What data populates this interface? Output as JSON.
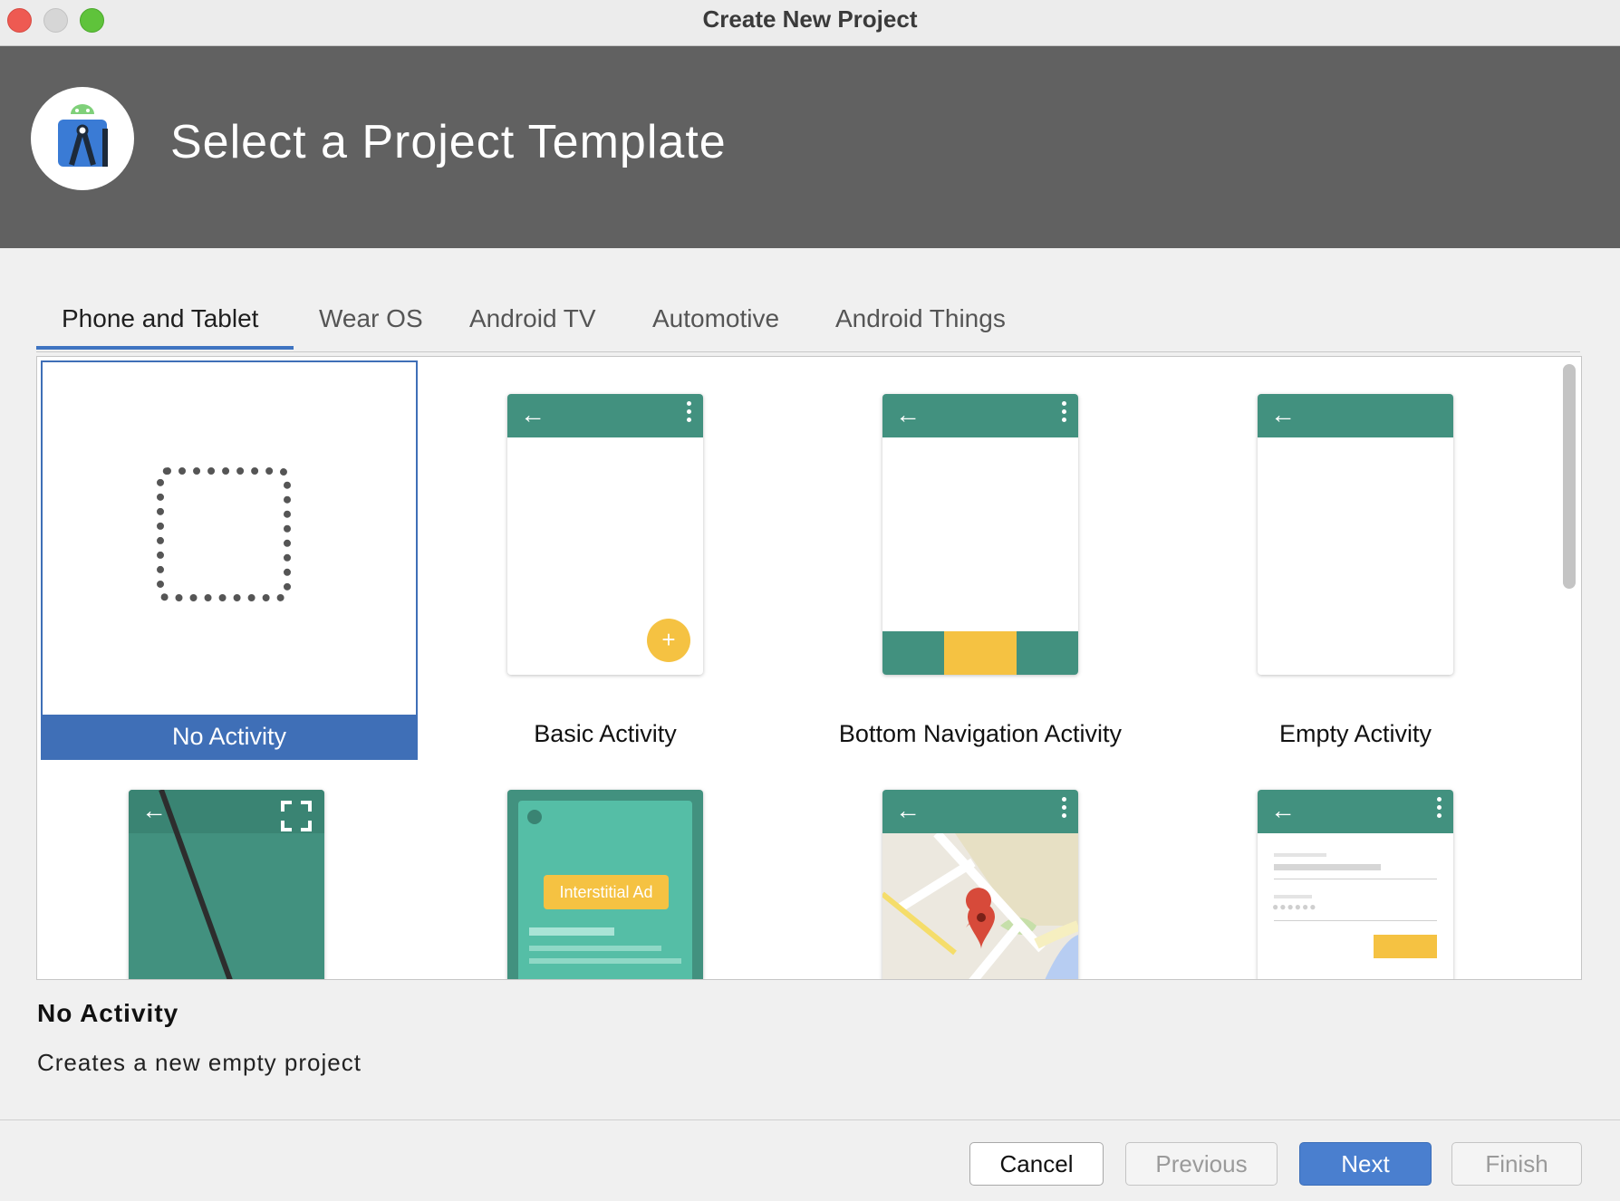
{
  "window": {
    "title": "Create New Project"
  },
  "header": {
    "title": "Select a Project Template",
    "logo_icon": "android-studio-logo"
  },
  "tabs": [
    {
      "label": "Phone and Tablet",
      "active": true
    },
    {
      "label": "Wear OS",
      "active": false
    },
    {
      "label": "Android TV",
      "active": false
    },
    {
      "label": "Automotive",
      "active": false
    },
    {
      "label": "Android Things",
      "active": false
    }
  ],
  "templates": [
    {
      "label": "No Activity",
      "selected": true
    },
    {
      "label": "Basic Activity"
    },
    {
      "label": "Bottom Navigation Activity"
    },
    {
      "label": "Empty Activity"
    }
  ],
  "preview_ad": {
    "label": "Interstitial Ad"
  },
  "detail": {
    "title": "No Activity",
    "description": "Creates a new empty project"
  },
  "buttons": {
    "cancel": "Cancel",
    "previous": "Previous",
    "next": "Next",
    "finish": "Finish"
  },
  "colors": {
    "accent": "#3f6fb7",
    "appbar": "#42917f",
    "fab": "#f5c242",
    "banner": "#616161"
  }
}
